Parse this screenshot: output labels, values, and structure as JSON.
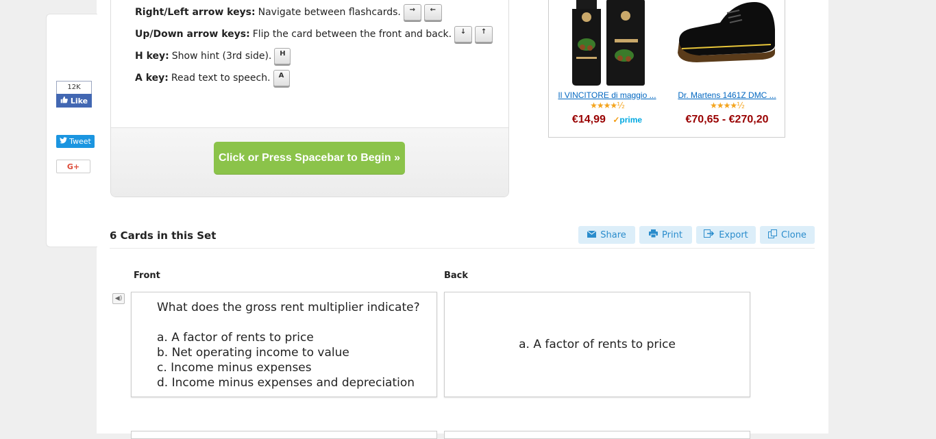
{
  "social": {
    "fb_count": "12K",
    "fb_like": "Like",
    "tweet": "Tweet",
    "gplus": "G+"
  },
  "instructions": [
    {
      "key": "Right/Left arrow keys:",
      "desc": "Navigate between flashcards.",
      "keys": [
        "→",
        "←"
      ]
    },
    {
      "key": "Up/Down arrow keys:",
      "desc": "Flip the card between the front and back.",
      "keys": [
        "↓",
        "↑"
      ]
    },
    {
      "key": "H key:",
      "desc": "Show hint (3rd side).",
      "keys": [
        "H"
      ]
    },
    {
      "key": "A key:",
      "desc": "Read text to speech.",
      "keys": [
        "A"
      ]
    }
  ],
  "begin_button": "Click or Press Spacebar to Begin »",
  "ad": {
    "items": [
      {
        "title": "Il VINCITORE di maggio ...",
        "rating": "★★★★½",
        "price": "€14,99",
        "prime": "prime"
      },
      {
        "title": "Dr. Martens 1461Z DMC ...",
        "rating": "★★★★½",
        "price": "€70,65 - €270,20"
      }
    ]
  },
  "set": {
    "title": "6 Cards in this Set",
    "actions": {
      "share": "Share",
      "print": "Print",
      "export": "Export",
      "clone": "Clone"
    }
  },
  "columns": {
    "front": "Front",
    "back": "Back"
  },
  "cards": [
    {
      "front": "What does the gross rent multiplier indicate?\n\na. A factor of rents to price\nb. Net operating income to value\nc. Income minus expenses\nd. Income minus expenses and depreciation",
      "back": "a. A factor of rents to price"
    }
  ],
  "colors": {
    "begin_button": "#8bc34a",
    "action_button_bg": "#dceef9",
    "action_button_text": "#2a8ccc",
    "price": "#990000",
    "facebook": "#4267b2",
    "twitter": "#1b95e0"
  }
}
